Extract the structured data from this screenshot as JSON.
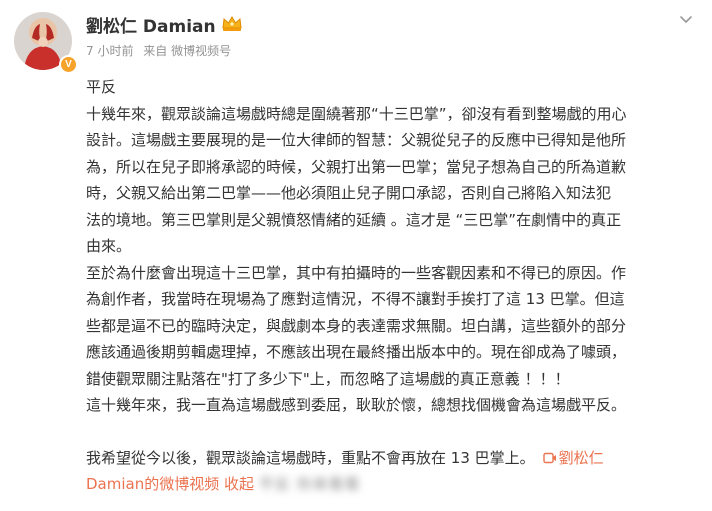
{
  "author": {
    "name": "劉松仁 Damian",
    "verified_badge": "V",
    "crown_icon": "crown-icon"
  },
  "meta": {
    "time": "7 小时前",
    "source": "来自 微博视频号"
  },
  "post": {
    "lines": [
      "平反",
      "十幾年來，觀眾談論這場戲時總是圍繞著那“十三巴掌”，卻沒有看到整場戲的用心",
      "設計。這場戲主要展現的是一位大律師的智慧：父親從兒子的反應中已得知是他所",
      "為，所以在兒子即將承認的時候，父親打出第一巴掌；當兒子想為自己的所為道歉",
      "時，父親又給出第二巴掌——他必須阻止兒子開口承認，否則自己將陷入知法犯",
      "法的境地。第三巴掌則是父親憤怒情緒的延續 。這才是 “三巴掌”在劇情中的真正",
      "由來。",
      "至於為什麼會出現這十三巴掌，其中有拍攝時的一些客觀因素和不得已的原因。作",
      "為創作者，我當時在現場為了應對這情況，不得不讓對手挨打了這 13 巴掌。但這",
      "些都是逼不已的臨時決定，與戲劇本身的表達需求無關。坦白講，這些額外的部分",
      "應該通過後期剪輯處理掉，不應該出現在最終播出版本中的。現在卻成為了噱頭，",
      "錯使觀眾關注點落在\"打了多少下\"上，而忽略了這場戲的真正意義 ！！！",
      "這十幾年來，我一直為這場戲感到委屈，耿耿於懷，總想找個機會為這場戲平反。"
    ],
    "closing": "我希望從今以後，觀眾談論這場戲時，重點不會再放在 13 巴掌上。",
    "video_link_part1": "劉松仁",
    "video_link_part2": "Damian的微博视频",
    "collapse_label": "收起",
    "blurred_text": "平反 你来看看"
  }
}
